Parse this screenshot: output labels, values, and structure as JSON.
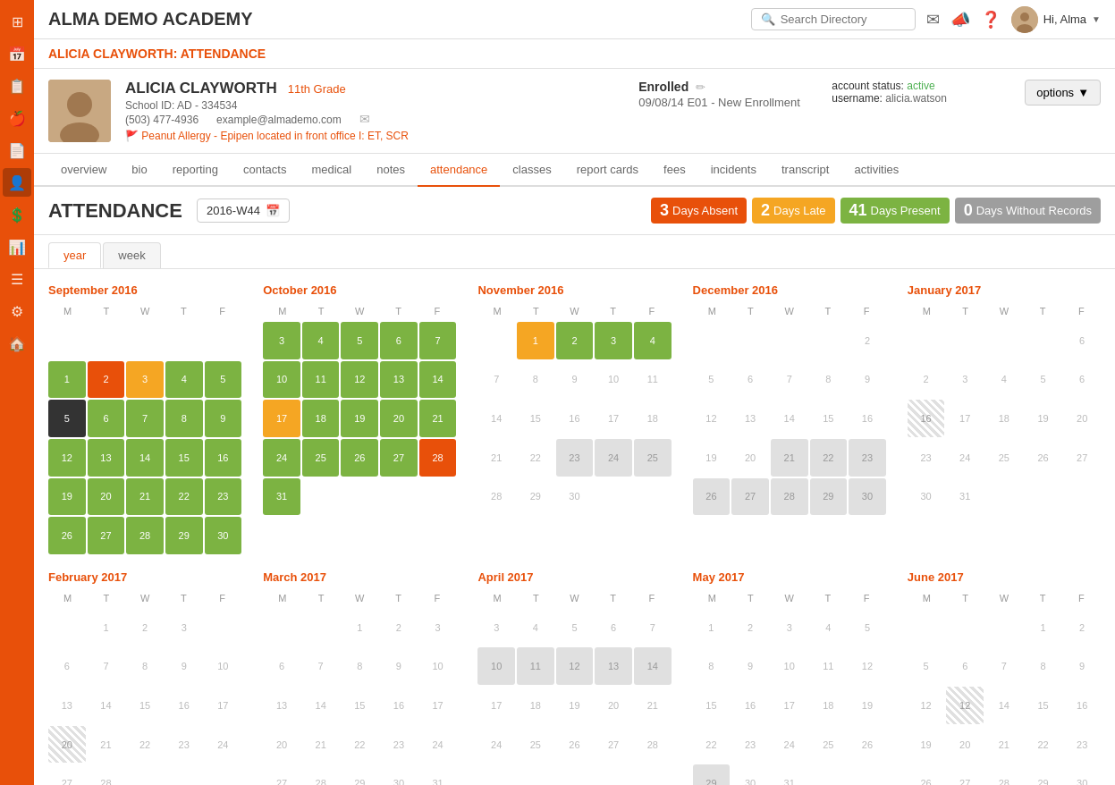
{
  "app": {
    "school_name": "ALMA DEMO ACADEMY",
    "search_placeholder": "Search Directory",
    "hi_text": "Hi, Alma"
  },
  "sidebar": {
    "icons": [
      "⊞",
      "📅",
      "📋",
      "🍎",
      "📄",
      "👤",
      "💰",
      "📊",
      "⚙",
      "🏠"
    ]
  },
  "breadcrumb": "ALICIA CLAYWORTH: ATTENDANCE",
  "student": {
    "name": "ALICIA CLAYWORTH",
    "grade": "11th Grade",
    "school_id": "School ID: AD - 334534",
    "phone": "(503) 477-4936",
    "email": "example@almademo.com",
    "allergy": "🚩 Peanut Allergy - Epipen located in front office I: ET, SCR",
    "enrollment_title": "Enrolled",
    "enrollment_date": "09/08/14",
    "enrollment_label": "E01 - New Enrollment",
    "account_status_label": "account status:",
    "account_status": "active",
    "username_label": "username:",
    "username": "alicia.watson"
  },
  "options_label": "options",
  "tabs": [
    "overview",
    "bio",
    "reporting",
    "contacts",
    "medical",
    "notes",
    "attendance",
    "classes",
    "report cards",
    "fees",
    "incidents",
    "transcript",
    "activities"
  ],
  "active_tab": "attendance",
  "attendance": {
    "title": "ATTENDANCE",
    "week": "2016-W44",
    "days_absent_num": "3",
    "days_absent_label": "Days Absent",
    "days_late_num": "2",
    "days_late_label": "Days Late",
    "days_present_num": "41",
    "days_present_label": "Days Present",
    "days_norecord_num": "0",
    "days_norecord_label": "Days Without Records"
  },
  "view_tabs": [
    "year",
    "week"
  ],
  "active_view": "year"
}
